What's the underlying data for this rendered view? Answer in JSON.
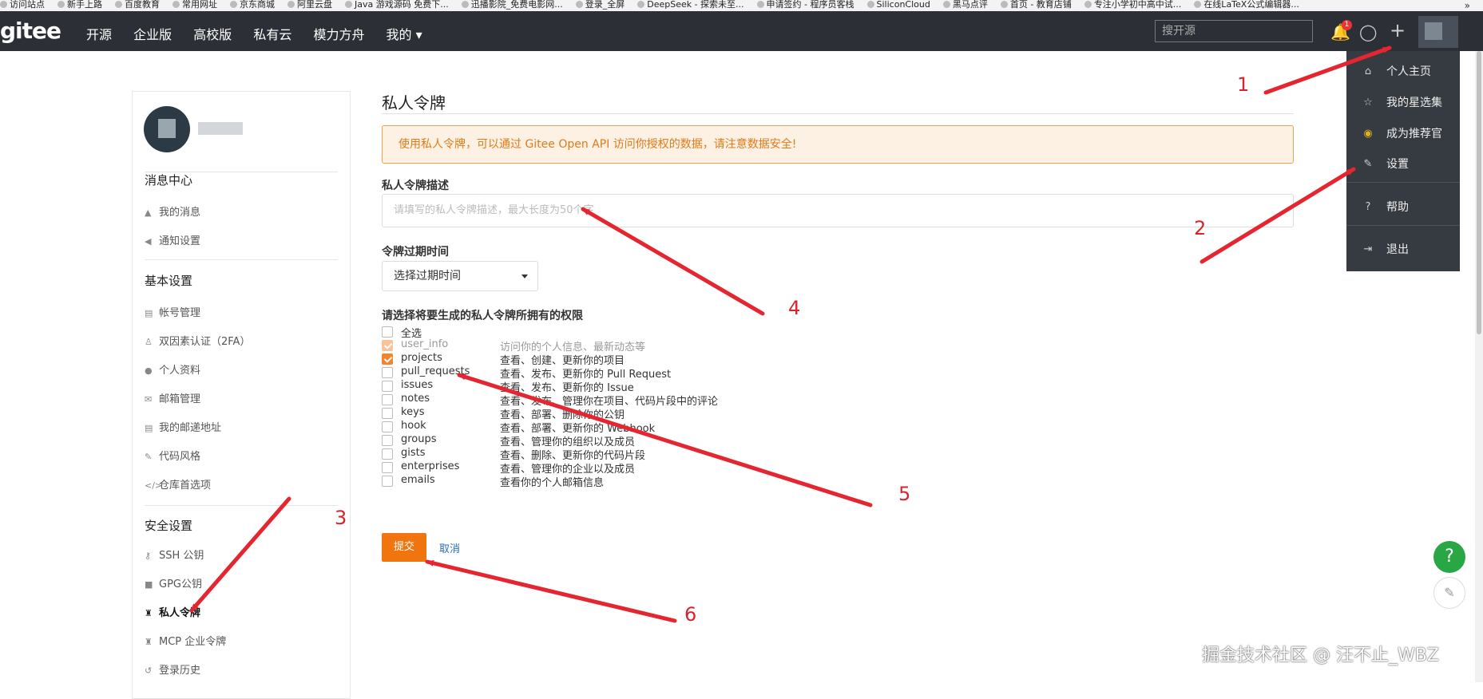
{
  "bookmarks": [
    "访问站点",
    "新手上路",
    "百度教育",
    "常用网址",
    "京东商城",
    "阿里云盘",
    "Java 游戏源码 免费下...",
    "迅播影院_免费电影网...",
    "登录_全屏",
    "DeepSeek - 探索未至...",
    "申请签约 - 程序员客栈",
    "SiliconCloud",
    "黑马点评",
    "首页 - 教育店铺",
    "专注小学初中高中试...",
    "在线LaTeX公式编辑器..."
  ],
  "bookmarks_more": "»",
  "nav": {
    "logo": "gitee",
    "links": [
      "开源",
      "企业版",
      "高校版",
      "私有云",
      "模力方舟",
      "我的 ▾"
    ],
    "search_placeholder": "搜开源",
    "notification_count": "1"
  },
  "dropdown": {
    "items": [
      {
        "icon": "⌂",
        "label": "个人主页"
      },
      {
        "icon": "☆",
        "label": "我的星选集"
      },
      {
        "icon": "◉",
        "label": "成为推荐官"
      },
      {
        "icon": "✎",
        "label": "设置"
      },
      {
        "icon": "?",
        "label": "帮助"
      },
      {
        "icon": "⇥",
        "label": "退出"
      }
    ]
  },
  "sidebar": {
    "groups": [
      {
        "title": "消息中心",
        "items": [
          {
            "icon": "🔔",
            "label": "我的消息"
          },
          {
            "icon": "🔊",
            "label": "通知设置"
          }
        ]
      },
      {
        "title": "基本设置",
        "items": [
          {
            "icon": "▤",
            "label": "帐号管理"
          },
          {
            "icon": "♙",
            "label": "双因素认证（2FA）"
          },
          {
            "icon": "●",
            "label": "个人资料"
          },
          {
            "icon": "✉",
            "label": "邮箱管理"
          },
          {
            "icon": "▤",
            "label": "我的邮递地址"
          },
          {
            "icon": "✎",
            "label": "代码风格"
          },
          {
            "icon": "</>",
            "label": "仓库首选项"
          }
        ]
      },
      {
        "title": "安全设置",
        "items": [
          {
            "icon": "⚷",
            "label": "SSH 公钥"
          },
          {
            "icon": "🔒",
            "label": "GPG公钥"
          },
          {
            "icon": "♜",
            "label": "私人令牌"
          },
          {
            "icon": "♜",
            "label": "MCP 企业令牌"
          },
          {
            "icon": "↺",
            "label": "登录历史"
          }
        ]
      }
    ]
  },
  "main": {
    "title": "私人令牌",
    "alert": "使用私人令牌，可以通过 Gitee Open API 访问你授权的数据，请注意数据安全!",
    "desc_label": "私人令牌描述",
    "desc_placeholder": "请填写的私人令牌描述，最大长度为50个字",
    "expire_label": "令牌过期时间",
    "expire_select": "选择过期时间",
    "perm_label": "请选择将要生成的私人令牌所拥有的权限",
    "select_all": "全选",
    "permissions": [
      {
        "name": "user_info",
        "desc": "访问你的个人信息、最新动态等",
        "state": "disabled"
      },
      {
        "name": "projects",
        "desc": "查看、创建、更新你的项目",
        "state": "checked"
      },
      {
        "name": "pull_requests",
        "desc": "查看、发布、更新你的 Pull Request",
        "state": "unchecked"
      },
      {
        "name": "issues",
        "desc": "查看、发布、更新你的 Issue",
        "state": "unchecked"
      },
      {
        "name": "notes",
        "desc": "查看、发布、管理你在项目、代码片段中的评论",
        "state": "unchecked"
      },
      {
        "name": "keys",
        "desc": "查看、部署、删除你的公钥",
        "state": "unchecked"
      },
      {
        "name": "hook",
        "desc": "查看、部署、更新你的 Webhook",
        "state": "unchecked"
      },
      {
        "name": "groups",
        "desc": "查看、管理你的组织以及成员",
        "state": "unchecked"
      },
      {
        "name": "gists",
        "desc": "查看、删除、更新你的代码片段",
        "state": "unchecked"
      },
      {
        "name": "enterprises",
        "desc": "查看、管理你的企业以及成员",
        "state": "unchecked"
      },
      {
        "name": "emails",
        "desc": "查看你的个人邮箱信息",
        "state": "unchecked"
      }
    ],
    "submit": "提交",
    "cancel": "取消"
  },
  "float": {
    "help": "?",
    "feedback": "✎"
  },
  "annotations": [
    "1",
    "2",
    "3",
    "4",
    "5",
    "6"
  ],
  "watermark": "掘金技术社区 @ 汪不止_WBZ",
  "colors": {
    "nav_bg": "#2c3036",
    "accent": "#f0750f",
    "arrow": "#e52530",
    "help": "#2aa745"
  }
}
